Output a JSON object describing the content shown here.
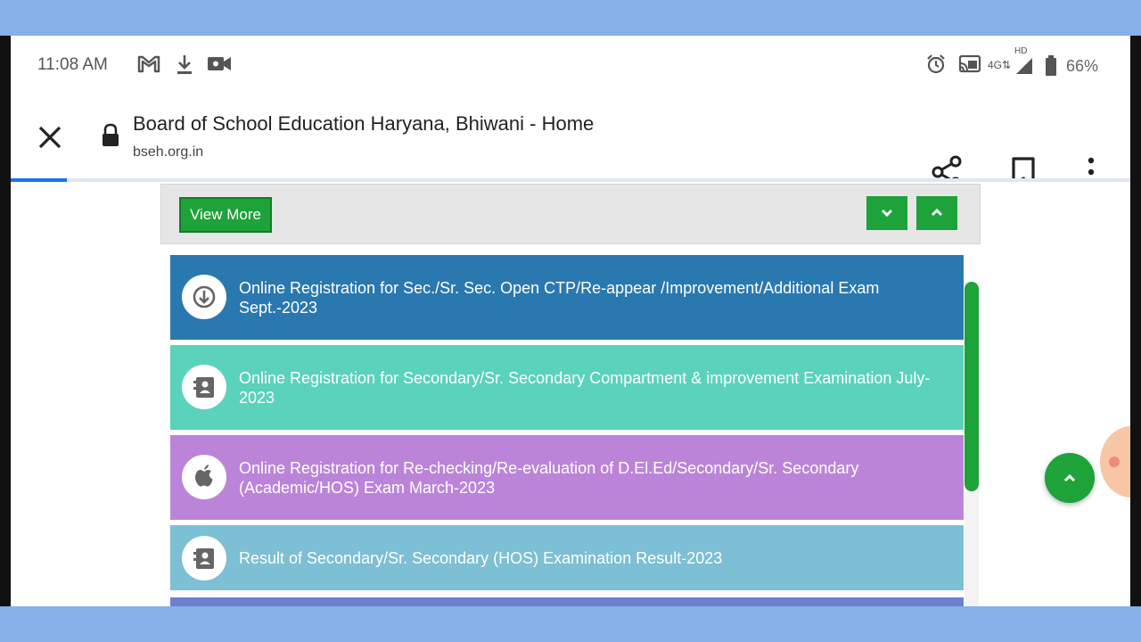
{
  "status_bar": {
    "time": "11:08 AM",
    "network_label": "4G",
    "hd_label": "HD",
    "battery": "66%",
    "left_icons": [
      "gmail-icon",
      "download-icon",
      "video-camera-icon"
    ],
    "right_icons": [
      "alarm-icon",
      "cast-icon",
      "network-4g-icon",
      "signal-icon",
      "battery-icon"
    ]
  },
  "browser": {
    "page_title": "Board of School Education Haryana, Bhiwani - Home",
    "url": "bseh.org.in",
    "load_progress": 0.05,
    "actions": [
      "share-icon",
      "bookmark-icon",
      "more-vert-icon"
    ]
  },
  "panel": {
    "view_more_label": "View More"
  },
  "news": [
    {
      "text": "Online Registration for Sec./Sr. Sec. Open CTP/Re-appear /Improvement/Additional Exam Sept.-2023",
      "icon": "download-circle-icon",
      "color": "#2a78b0"
    },
    {
      "text": "Online Registration for Secondary/Sr. Secondary Compartment & improvement Examination July-2023",
      "icon": "contact-book-icon",
      "color": "#5ad2bc"
    },
    {
      "text": "Online Registration for Re-checking/Re-evaluation of D.El.Ed/Secondary/Sr. Secondary (Academic/HOS) Exam March-2023",
      "icon": "apple-icon",
      "color": "#bb84d9"
    },
    {
      "text": "Result of Secondary/Sr. Secondary (HOS) Examination Result-2023",
      "icon": "contact-book-icon",
      "color": "#7dbfd4"
    },
    {
      "text": "",
      "icon": "",
      "color": "#6f7fcf"
    }
  ],
  "colors": {
    "accent_green": "#1ea23a",
    "progress_blue": "#1a73e8",
    "frame_blue": "#86b0e6"
  }
}
